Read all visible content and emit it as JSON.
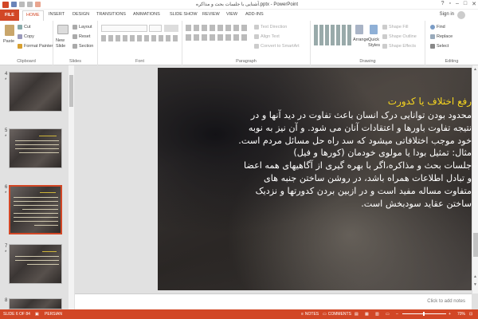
{
  "window": {
    "title": "آشنایی با جلسات بحث و مذاکره.pptx - PowerPoint",
    "controls": [
      "?",
      "▫",
      "–",
      "□",
      "✕"
    ]
  },
  "tabs": [
    "FILE",
    "HOME",
    "INSERT",
    "DESIGN",
    "TRANSITIONS",
    "ANIMATIONS",
    "SLIDE SHOW",
    "REVIEW",
    "VIEW",
    "ADD-INS"
  ],
  "account": {
    "sign_in": "Sign in"
  },
  "ribbon": {
    "clipboard": {
      "label": "Clipboard",
      "paste": "Paste",
      "cut": "Cut",
      "copy": "Copy",
      "format_painter": "Format Painter"
    },
    "slides": {
      "label": "Slides",
      "new_slide": "New Slide",
      "layout": "Layout",
      "reset": "Reset",
      "section": "Section"
    },
    "font": {
      "label": "Font"
    },
    "paragraph": {
      "label": "Paragraph",
      "text_direction": "Text Direction",
      "align_text": "Align Text",
      "convert_smartart": "Convert to SmartArt"
    },
    "drawing": {
      "label": "Drawing",
      "arrange": "Arrange",
      "quick_styles": "Quick Styles",
      "shape_fill": "Shape Fill",
      "shape_outline": "Shape Outline",
      "shape_effects": "Shape Effects"
    },
    "editing": {
      "label": "Editing",
      "find": "Find",
      "replace": "Replace",
      "select": "Select"
    }
  },
  "thumbnails": [
    {
      "number": "4",
      "star": "*",
      "selected": false
    },
    {
      "number": "5",
      "star": "*",
      "selected": false
    },
    {
      "number": "6",
      "star": "*",
      "selected": true
    },
    {
      "number": "7",
      "star": "*",
      "selected": false
    },
    {
      "number": "8",
      "star": "",
      "selected": false
    }
  ],
  "slide": {
    "title": "رفع اختلاف یا کدورت",
    "body": [
      "محدود بودن توانایی درک انسان باعث تفاوت در دید آنها و در",
      "نتیجه تفاوت باورها و اعتقادات آنان می شود. و آن نیز به نوبه",
      "خود موجب اختلافاتی میشود که سد راه حل مسائل مردم است.",
      "مثال: تمثیل بودا یا مولوی خودمان (کورها و فیل)",
      "جلسات بحث و مذاکره،اگر با بهره گیری از آگاهیهای همه اعضا",
      "و تبادل اطلاعات همراه باشد، در روشن ساختن جنبه های",
      "متفاوت مساله مفید است و در ازبین بردن کدورتها و نزدیک",
      "ساختن عقاید سودبخش است."
    ]
  },
  "notes": {
    "placeholder": "Click to add notes"
  },
  "status": {
    "slide_info": "SLIDE 6 OF 84",
    "language": "PERSIAN",
    "notes": "NOTES",
    "comments": "COMMENTS",
    "zoom": "70%"
  },
  "colors": {
    "accent": "#d24726",
    "slide_title": "#f6d51f",
    "slide_text": "#ffffff"
  }
}
